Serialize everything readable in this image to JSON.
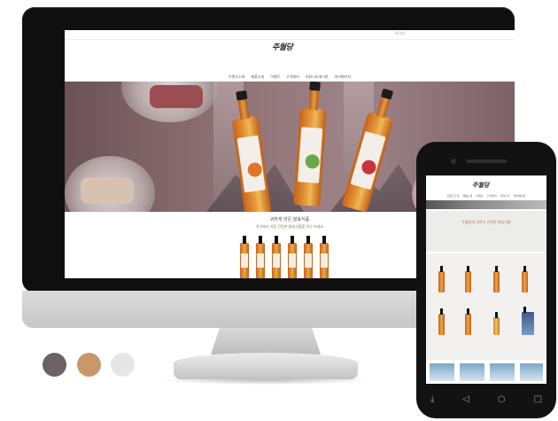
{
  "desktop": {
    "util_text": "로그인",
    "logo": "주월당",
    "nav": [
      "브랜드소개",
      "제품소개",
      "이벤트",
      "고객센터",
      "커뮤니티게시판",
      "마이페이지"
    ],
    "section_title": "귀하게 만든 발효식품",
    "section_sub": "전국에서 가장 건강한 발효식품을 만나 보세요"
  },
  "phone": {
    "logo": "주월당",
    "nav": [
      "브랜드소개",
      "제품소개",
      "이벤트",
      "고객센터",
      "커뮤니티",
      "마이페이지"
    ],
    "heading": "주월당의 귀하고 건강한 발효식품"
  },
  "colors": {
    "swatch_1": "#6b6264",
    "swatch_2": "#c9976a",
    "swatch_3": "#e6e6e6"
  }
}
